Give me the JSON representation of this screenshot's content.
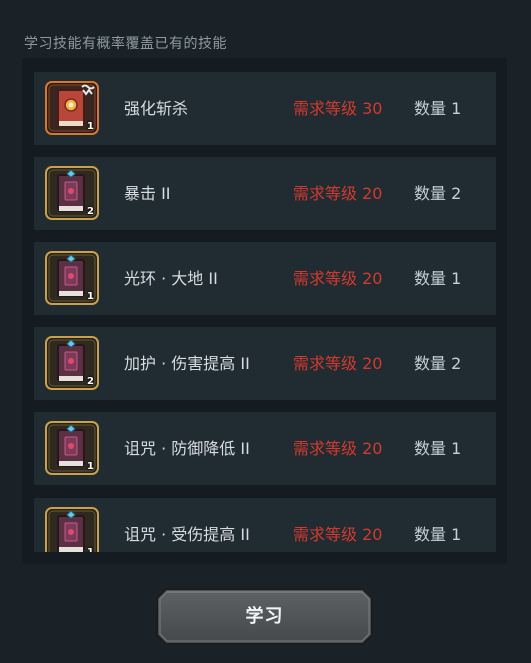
{
  "hint": "学习技能有概率覆盖已有的技能",
  "skills": [
    {
      "name": "强化斩杀",
      "requirement": "需求等级 30",
      "count": "数量 1",
      "badge": "1",
      "icon": "red-book-icon"
    },
    {
      "name": "暴击 II",
      "requirement": "需求等级 20",
      "count": "数量 2",
      "badge": "2",
      "icon": "skill-book-icon"
    },
    {
      "name": "光环 · 大地 II",
      "requirement": "需求等级 20",
      "count": "数量 1",
      "badge": "1",
      "icon": "skill-book-icon"
    },
    {
      "name": "加护 · 伤害提高 II",
      "requirement": "需求等级 20",
      "count": "数量 2",
      "badge": "2",
      "icon": "skill-book-icon"
    },
    {
      "name": "诅咒 · 防御降低 II",
      "requirement": "需求等级 20",
      "count": "数量 1",
      "badge": "1",
      "icon": "skill-book-icon"
    },
    {
      "name": "诅咒 · 受伤提高 II",
      "requirement": "需求等级 20",
      "count": "数量 1",
      "badge": "1",
      "icon": "skill-book-icon"
    }
  ],
  "learn_button": "学习",
  "colors": {
    "requirement": "#d23a2e",
    "row_bg": "#212b32",
    "selected_border": "#d9782c",
    "gold_border": "#c9a14a"
  }
}
